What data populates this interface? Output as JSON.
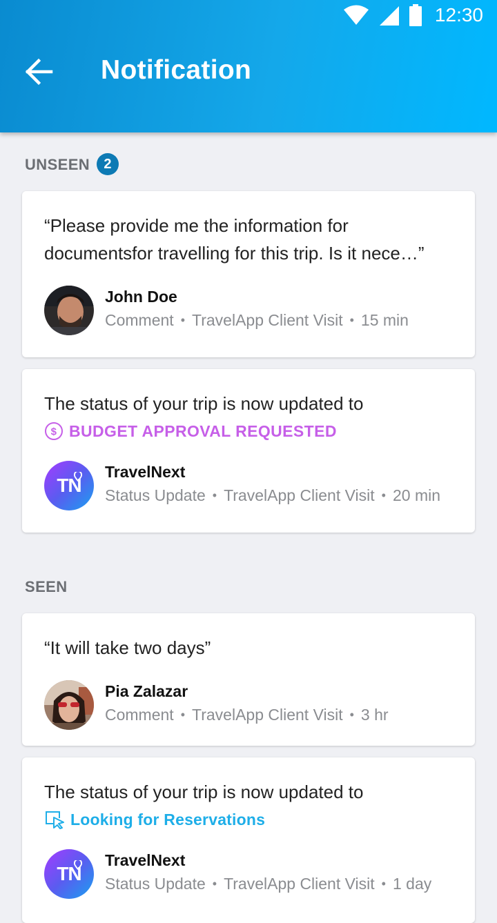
{
  "status_bar": {
    "time": "12:30"
  },
  "header": {
    "title": "Notification"
  },
  "sections": {
    "unseen": {
      "label": "UNSEEN",
      "count": "2"
    },
    "seen": {
      "label": "SEEN"
    }
  },
  "notifications": [
    {
      "text": "“Please provide me the information for documentsfor travelling for this trip. Is it nece…”",
      "author": "John Doe",
      "type": "Comment",
      "context": "TravelApp Client Visit",
      "time": "15 min"
    },
    {
      "text": "The status of your trip is now updated to",
      "status_label": "BUDGET APPROVAL REQUESTED",
      "status_color": "#c65fe8",
      "author": "TravelNext",
      "avatar_text": "TN",
      "type": "Status Update",
      "context": "TravelApp Client Visit",
      "time": "20 min"
    },
    {
      "text": "“It will take two days”",
      "author": "Pia Zalazar",
      "type": "Comment",
      "context": "TravelApp Client Visit",
      "time": "3 hr"
    },
    {
      "text": "The status of your trip is now updated to",
      "status_label": "Looking for Reservations",
      "status_color": "#1eaee8",
      "author": "TravelNext",
      "avatar_text": "TN",
      "type": "Status Update",
      "context": "TravelApp Client Visit",
      "time": "1 day"
    }
  ],
  "separator": "•",
  "colors": {
    "header_start": "#0a8bd0",
    "header_end": "#00b8ff",
    "badge": "#0d7ab4",
    "background": "#eff0f4"
  }
}
